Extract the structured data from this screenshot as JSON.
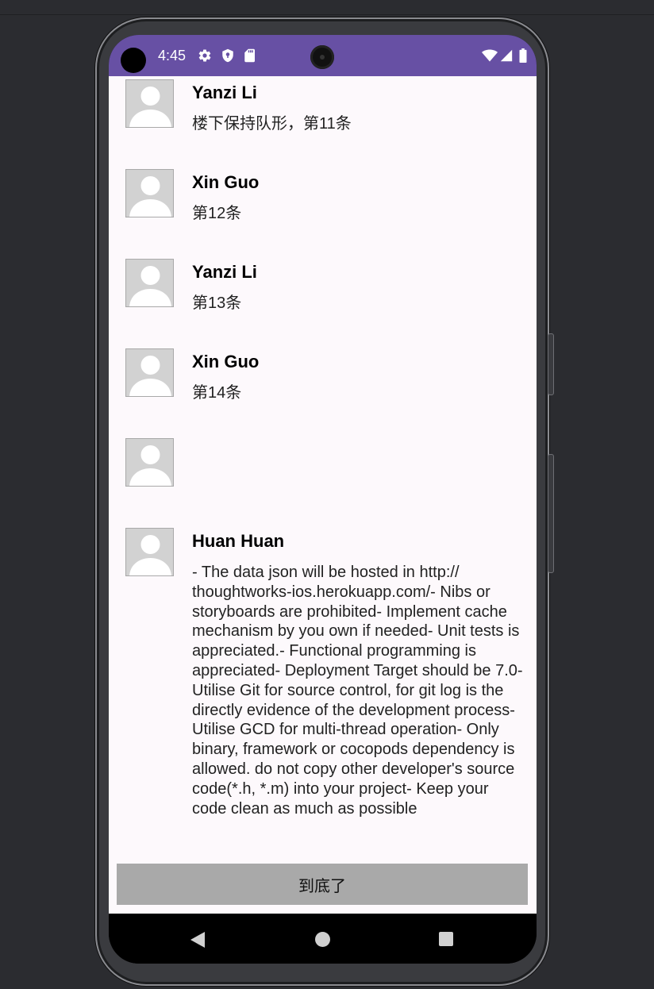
{
  "status_bar": {
    "time": "4:45",
    "left_icons": [
      "gear-icon",
      "shield-icon",
      "sd-card-icon"
    ],
    "right_icons": [
      "wifi-icon",
      "signal-icon",
      "battery-icon"
    ],
    "color": "#6750a4"
  },
  "feed": {
    "items": [
      {
        "name": "Yanzi Li",
        "content": "楼下保持队形，第11条"
      },
      {
        "name": "Xin Guo",
        "content": "第12条"
      },
      {
        "name": "Yanzi Li",
        "content": "第13条"
      },
      {
        "name": "Xin Guo",
        "content": "第14条"
      },
      {
        "name": "",
        "content": ""
      },
      {
        "name": "Huan Huan",
        "content": "- The data json will be hosted in http:// thoughtworks-ios.herokuapp.com/- Nibs or storyboards are prohibited- Implement cache mechanism by you own if needed- Unit tests is appreciated.- Functional programming is appreciated- Deployment Target should be 7.0- Utilise Git for source control, for git log is the directly evidence of the development process- Utilise GCD for multi-thread operation- Only binary, framework or cocopods dependency is allowed. do not copy other developer's source code(*.h, *.m) into your project- Keep your code clean as much as possible"
      }
    ]
  },
  "footer": {
    "label": "到底了"
  },
  "nav_bar": {
    "icons": [
      "back-icon",
      "home-icon",
      "recents-icon"
    ]
  }
}
